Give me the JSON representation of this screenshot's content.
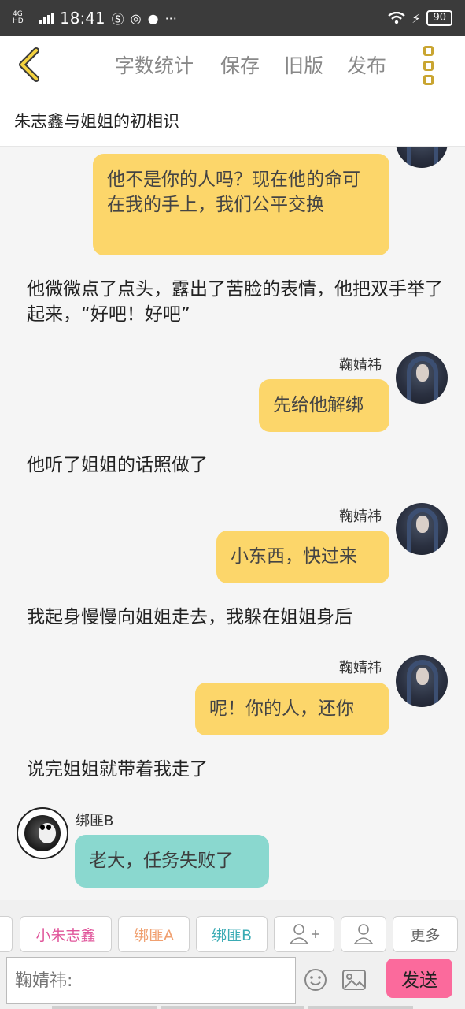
{
  "status": {
    "time": "18:41",
    "network": "4G HD",
    "battery": "90",
    "icons": [
      "signal-icon",
      "s-app-icon",
      "weibo-icon",
      "chat-icon",
      "more-dots-icon",
      "wifi-icon",
      "charging-icon",
      "battery-icon"
    ]
  },
  "toolbar": {
    "word_count": "字数统计",
    "save": "保存",
    "old_version": "旧版",
    "publish": "发布"
  },
  "story": {
    "title": "朱志鑫与姐姐的初相识"
  },
  "messages": [
    {
      "type": "bubble",
      "side": "right",
      "text": "他不是你的人吗？现在他的命可在我的手上，我们公平交换"
    },
    {
      "type": "narration",
      "text": "他微微点了点头，露出了苦脸的表情，他把双手举了起来，“好吧！好吧”"
    },
    {
      "type": "bubble",
      "side": "right",
      "speaker": "鞠婧祎",
      "text": "先给他解绑"
    },
    {
      "type": "narration",
      "text": "他听了姐姐的话照做了"
    },
    {
      "type": "bubble",
      "side": "right",
      "speaker": "鞠婧祎",
      "text": "小东西，快过来"
    },
    {
      "type": "narration",
      "text": "我起身慢慢向姐姐走去，我躲在姐姐身后"
    },
    {
      "type": "bubble",
      "side": "right",
      "speaker": "鞠婧祎",
      "text": "呢！你的人，还你"
    },
    {
      "type": "narration",
      "text": "说完姐姐就带着我走了"
    },
    {
      "type": "bubble",
      "side": "left",
      "speaker": "绑匪B",
      "text": "老大，任务失败了"
    }
  ],
  "characters": {
    "chips": [
      "小朱志鑫",
      "绑匪A",
      "绑匪B"
    ],
    "chip_colors": [
      "#e0549a",
      "#f0a070",
      "#3aabb4"
    ],
    "add_icon": "add-person-icon",
    "person_icon": "person-icon",
    "more": "更多"
  },
  "composer": {
    "placeholder": "鞠婧祎:",
    "send": "发送",
    "emoji_icon": "emoji-icon",
    "image_icon": "image-icon"
  }
}
